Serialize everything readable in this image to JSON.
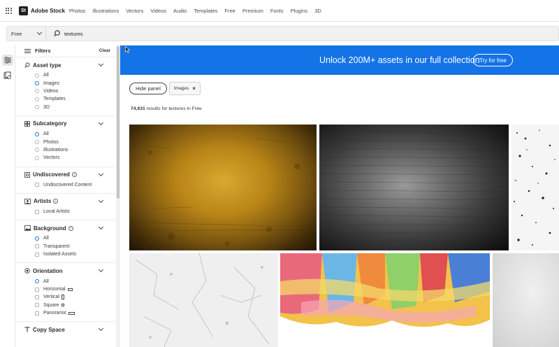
{
  "brand": {
    "logo_mark": "St",
    "name": "Adobe Stock"
  },
  "nav": {
    "links": [
      "Photos",
      "Illustrations",
      "Vectors",
      "Videos",
      "Audio",
      "Templates",
      "Free",
      "Premium",
      "Fonts",
      "Plugins",
      "3D"
    ]
  },
  "search": {
    "scope": "Free",
    "query": "textures"
  },
  "filters": {
    "title": "Filters",
    "clear_label": "Clear",
    "asset_type": {
      "title": "Asset type",
      "options": [
        "All",
        "Images",
        "Videos",
        "Templates",
        "3D"
      ],
      "selected": "Images"
    },
    "subcategory": {
      "title": "Subcategory",
      "options": [
        "All",
        "Photos",
        "Illustrations",
        "Vectors"
      ],
      "selected": "All"
    },
    "undiscovered": {
      "title": "Undiscovered",
      "options": [
        "Undiscovered Content"
      ]
    },
    "artists": {
      "title": "Artists",
      "options": [
        "Local Artists"
      ]
    },
    "background": {
      "title": "Background",
      "options": [
        "All",
        "Transparent",
        "Isolated Assets"
      ],
      "selected": "All"
    },
    "orientation": {
      "title": "Orientation",
      "options": [
        "All",
        "Horizontal",
        "Vertical",
        "Square",
        "Panoramic"
      ],
      "selected": "All"
    },
    "copy_space": {
      "title": "Copy Space"
    }
  },
  "banner": {
    "text": "Unlock 200M+ assets in our full collection",
    "button": "Try for free",
    "color": "#1473e6"
  },
  "toolbar": {
    "hide_panel": "Hide panel",
    "chip_label": "Images"
  },
  "results": {
    "count": "74,631",
    "mid": "results for",
    "query": "textures",
    "tail": "in Free"
  },
  "icons": [
    "apps-grid-icon",
    "search-icon",
    "filter-sliders-icon",
    "asset-type-icon",
    "subcategory-grid-icon",
    "undiscovered-icon",
    "artists-icon",
    "background-icon",
    "orientation-icon",
    "copy-space-icon",
    "info-icon",
    "chevron-down-icon",
    "close-icon"
  ],
  "colors": {
    "accent": "#1473e6"
  }
}
